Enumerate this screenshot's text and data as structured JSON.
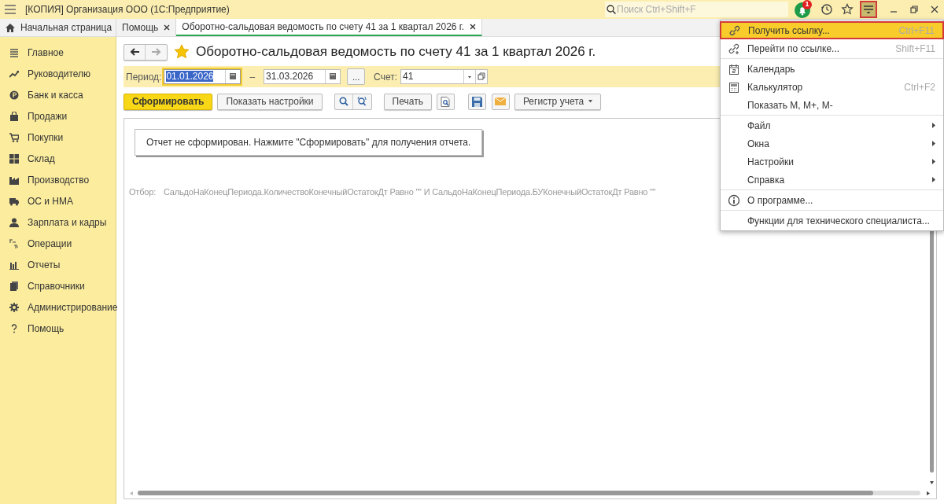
{
  "window": {
    "title": "[КОПИЯ] Организация ООО  (1С:Предприятие)"
  },
  "search": {
    "placeholder": "Поиск Ctrl+Shift+F"
  },
  "notifications": {
    "count": "1"
  },
  "tabs": [
    {
      "label": "Начальная страница",
      "selected": false,
      "closable": false,
      "kind": "home"
    },
    {
      "label": "Помощь",
      "selected": false,
      "closable": true,
      "kind": "doc"
    },
    {
      "label": "Оборотно-сальдовая ведомость по счету 41 за 1 квартал 2026 г.",
      "selected": true,
      "closable": true,
      "kind": "doc"
    }
  ],
  "sidebar": {
    "items": [
      "Главное",
      "Руководителю",
      "Банк и касса",
      "Продажи",
      "Покупки",
      "Склад",
      "Производство",
      "ОС и НМА",
      "Зарплата и кадры",
      "Операции",
      "Отчеты",
      "Справочники",
      "Администрирование",
      "Помощь"
    ]
  },
  "report": {
    "title": "Оборотно-сальдовая ведомость по счету 41 за 1 квартал 2026 г.",
    "favorite": true,
    "period_label": "Период:",
    "period_from": {
      "value": "01.01.2026",
      "focused": true
    },
    "dash": "–",
    "period_to": {
      "value": "31.03.2026",
      "focused": false
    },
    "more_button": "...",
    "account_label": "Счет:",
    "account": "41",
    "buttons": {
      "generate": "Сформировать",
      "settings": "Показать настройки",
      "print": "Печать",
      "register": "Регистр учета"
    },
    "message": "Отчет не сформирован. Нажмите \"Сформировать\" для получения отчета.",
    "filter_label": "Отбор:",
    "filter": "СальдоНаКонецПериода.КоличествоКонечныйОстатокДт Равно \"\" И СальдоНаКонецПериода.БУКонечныйОстатокДт Равно \"\""
  },
  "menu": {
    "groups": [
      [
        {
          "label": "Получить ссылку...",
          "shortcut": "Ctrl+F11",
          "selected": true,
          "submenu": false
        },
        {
          "label": "Перейти по ссылке...",
          "shortcut": "Shift+F11",
          "selected": false,
          "submenu": false
        }
      ],
      [
        {
          "label": "Календарь",
          "selected": false,
          "submenu": false
        },
        {
          "label": "Калькулятор",
          "shortcut": "Ctrl+F2",
          "selected": false,
          "submenu": false
        },
        {
          "label": "Показать M, M+, M-",
          "selected": false,
          "submenu": false
        }
      ],
      [
        {
          "label": "Файл",
          "selected": false,
          "submenu": true
        },
        {
          "label": "Окна",
          "selected": false,
          "submenu": true
        },
        {
          "label": "Настройки",
          "selected": false,
          "submenu": true
        },
        {
          "label": "Справка",
          "selected": false,
          "submenu": true
        }
      ],
      [
        {
          "label": "О программе...",
          "selected": false,
          "submenu": false
        }
      ],
      [
        {
          "label": "Функции для технического специалиста...",
          "selected": false,
          "submenu": false
        }
      ]
    ]
  }
}
